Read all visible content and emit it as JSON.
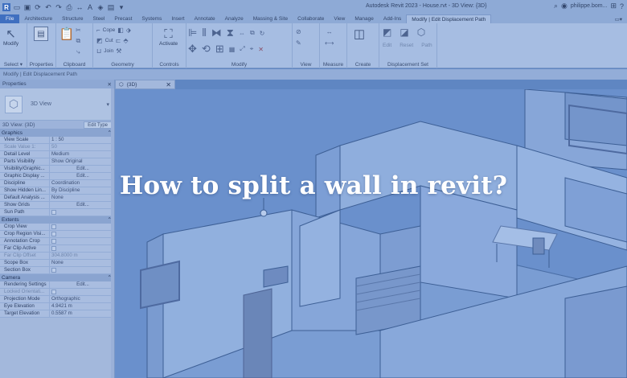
{
  "titlebar": {
    "title": "Autodesk Revit 2023 - House.rvt - 3D View: {3D}",
    "user": "philippe.bom...",
    "qat_icons": [
      "open-icon",
      "save-icon",
      "sync-icon",
      "undo-icon",
      "redo-icon",
      "print-icon",
      "measure-icon",
      "text-icon"
    ]
  },
  "tabs": [
    "File",
    "Architecture",
    "Structure",
    "Steel",
    "Precast",
    "Systems",
    "Insert",
    "Annotate",
    "Analyze",
    "Massing & Site",
    "Collaborate",
    "View",
    "Manage",
    "Add-Ins",
    "Modify | Edit Displacement Path"
  ],
  "active_tab": "Modify | Edit Displacement Path",
  "ribbon": {
    "select": {
      "button": "Modify",
      "label": "Select ▾"
    },
    "properties": {
      "label": "Properties"
    },
    "clipboard": {
      "label": "Clipboard"
    },
    "geometry": {
      "label": "Geometry",
      "cope": "Cope",
      "cut": "Cut",
      "join": "Join"
    },
    "controls": {
      "button": "Activate",
      "label": "Controls"
    },
    "modify": {
      "label": "Modify"
    },
    "view": {
      "label": "View"
    },
    "measure": {
      "label": "Measure"
    },
    "create": {
      "label": "Create"
    },
    "displacement": {
      "label": "Displacement Set",
      "edit": "Edit",
      "reset": "Reset",
      "path": "Path"
    }
  },
  "optionsbar": {
    "text": "Modify | Edit Displacement Path"
  },
  "properties": {
    "title": "Properties",
    "close": "✕",
    "type_name": "3D View",
    "instance_filter": "3D View: {3D}",
    "edit_type": "Edit Type",
    "groups": [
      {
        "name": "Graphics",
        "rows": [
          {
            "name": "View Scale",
            "value": "1 : 50"
          },
          {
            "name": "Scale Value 1:",
            "value": "50",
            "dim": true
          },
          {
            "name": "Detail Level",
            "value": "Medium"
          },
          {
            "name": "Parts Visibility",
            "value": "Show Original"
          },
          {
            "name": "Visibility/Graphic...",
            "value": "Edit...",
            "button": true
          },
          {
            "name": "Graphic Display ...",
            "value": "Edit...",
            "button": true
          },
          {
            "name": "Discipline",
            "value": "Coordination"
          },
          {
            "name": "Show Hidden Lin...",
            "value": "By Discipline"
          },
          {
            "name": "Default Analysis ...",
            "value": "None"
          },
          {
            "name": "Show Grids",
            "value": "Edit...",
            "button": true
          },
          {
            "name": "Sun Path",
            "value": "",
            "check": false
          }
        ]
      },
      {
        "name": "Extents",
        "rows": [
          {
            "name": "Crop View",
            "value": "",
            "check": false
          },
          {
            "name": "Crop Region Visi...",
            "value": "",
            "check": false
          },
          {
            "name": "Annotation Crop",
            "value": "",
            "check": false
          },
          {
            "name": "Far Clip Active",
            "value": "",
            "check": false
          },
          {
            "name": "Far Clip Offset",
            "value": "304.8000 m",
            "dim": true
          },
          {
            "name": "Scope Box",
            "value": "None"
          },
          {
            "name": "Section Box",
            "value": "",
            "check": false
          }
        ]
      },
      {
        "name": "Camera",
        "rows": [
          {
            "name": "Rendering Settings",
            "value": "Edit...",
            "button": true
          },
          {
            "name": "Locked Orientati...",
            "value": "",
            "check": false
          },
          {
            "name": "Projection Mode",
            "value": "Orthographic"
          },
          {
            "name": "Eye Elevation",
            "value": "4.9421 m"
          },
          {
            "name": "Target Elevation",
            "value": "0.5587 m"
          }
        ]
      }
    ]
  },
  "view_tab": {
    "label": "{3D}",
    "close": "✕"
  },
  "headline": "How to split a wall in revit?"
}
